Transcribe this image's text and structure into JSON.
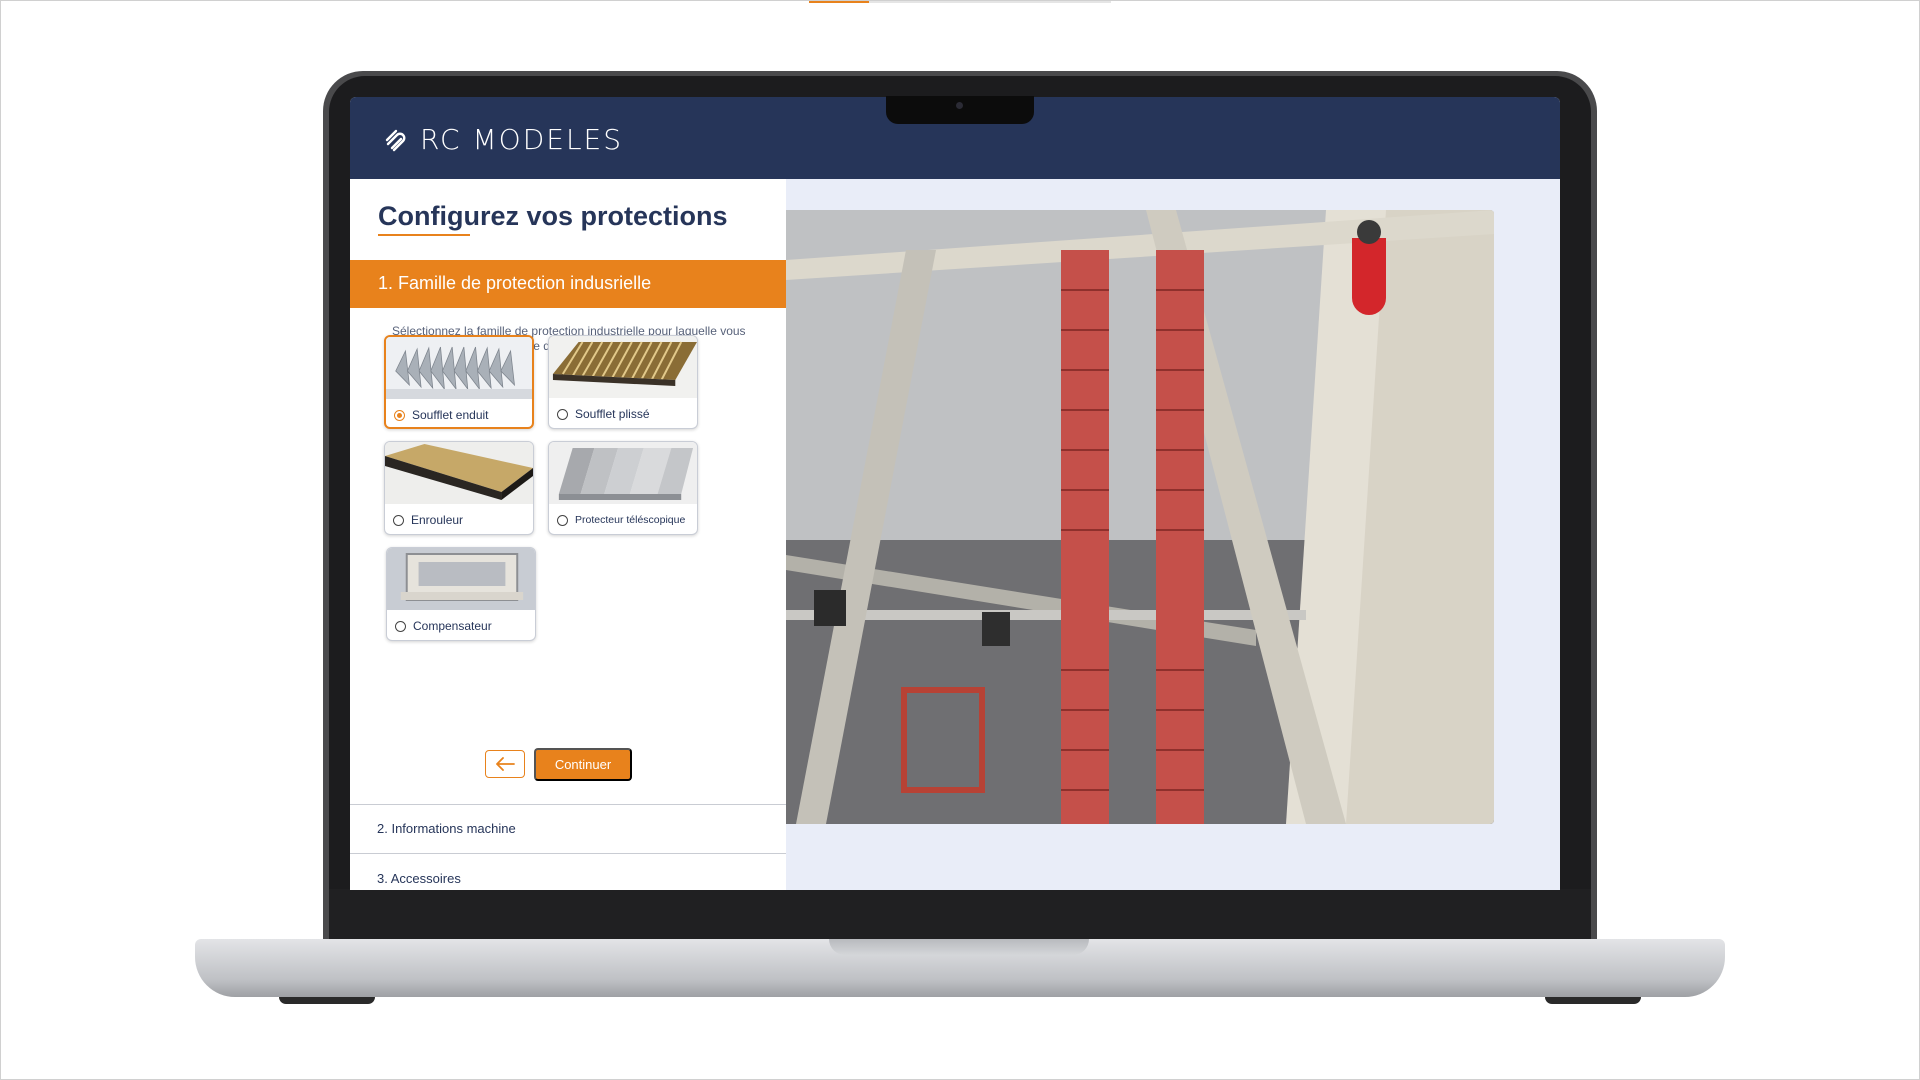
{
  "app": {
    "brand": "RC MODELES"
  },
  "page": {
    "title": "Configurez vos protections"
  },
  "steps": {
    "active": {
      "label": "1. Famille de protection indusrielle"
    },
    "next": [
      {
        "label": "2. Informations machine"
      },
      {
        "label": "3. Accessoires"
      }
    ]
  },
  "instructions": "Sélectionnez la famille de protection industrielle pour laquelle vous souhaitez recevoir une offre de prix",
  "options": [
    {
      "label": "Soufflet enduit",
      "selected": true,
      "icon": "coated-bellows-image"
    },
    {
      "label": "Soufflet plissé",
      "selected": false,
      "icon": "pleated-bellows-image"
    },
    {
      "label": "Enrouleur",
      "selected": false,
      "icon": "roller-cover-image"
    },
    {
      "label": "Protecteur téléscopique",
      "selected": false,
      "icon": "telescopic-cover-image"
    },
    {
      "label": "Compensateur",
      "selected": false,
      "icon": "expansion-joint-image"
    }
  ],
  "buttons": {
    "back_icon": "arrow-left-icon",
    "continue": "Continuer"
  },
  "progress": {
    "fraction": 0.2
  },
  "colors": {
    "brand_navy": "#263559",
    "accent_orange": "#e8821c",
    "panel_bg": "#e9edf8"
  }
}
